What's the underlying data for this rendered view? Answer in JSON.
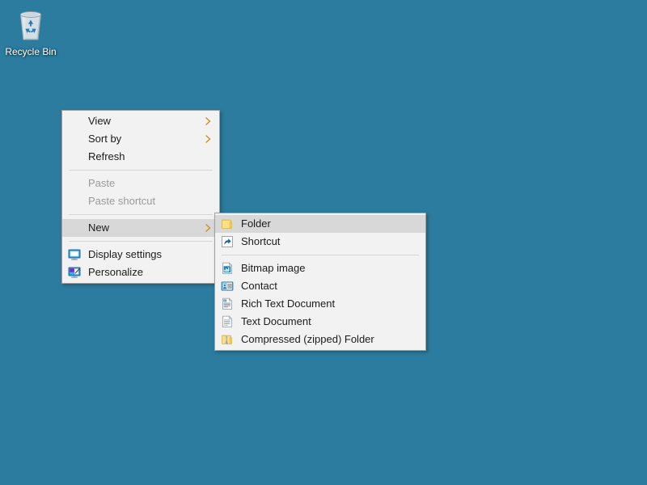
{
  "desktop": {
    "background_color": "#2b7c9e",
    "icons": [
      {
        "name": "recycle-bin",
        "label": "Recycle Bin",
        "icon": "recycle-bin-icon"
      }
    ]
  },
  "context_menu": {
    "items": [
      {
        "label": "View",
        "icon": "none",
        "submenu": true,
        "disabled": false,
        "highlight": false
      },
      {
        "label": "Sort by",
        "icon": "none",
        "submenu": true,
        "disabled": false,
        "highlight": false
      },
      {
        "label": "Refresh",
        "icon": "none",
        "submenu": false,
        "disabled": false,
        "highlight": false
      },
      {
        "separator": true
      },
      {
        "label": "Paste",
        "icon": "none",
        "submenu": false,
        "disabled": true,
        "highlight": false
      },
      {
        "label": "Paste shortcut",
        "icon": "none",
        "submenu": false,
        "disabled": true,
        "highlight": false
      },
      {
        "separator": true
      },
      {
        "label": "New",
        "icon": "none",
        "submenu": true,
        "disabled": false,
        "highlight": true
      },
      {
        "separator": true
      },
      {
        "label": "Display settings",
        "icon": "monitor-icon",
        "submenu": false,
        "disabled": false,
        "highlight": false
      },
      {
        "label": "Personalize",
        "icon": "monitor-brush-icon",
        "submenu": false,
        "disabled": false,
        "highlight": false
      }
    ]
  },
  "submenu": {
    "parent": "New",
    "items": [
      {
        "label": "Folder",
        "icon": "folder-icon",
        "highlight": true
      },
      {
        "label": "Shortcut",
        "icon": "shortcut-icon",
        "highlight": false
      },
      {
        "separator": true
      },
      {
        "label": "Bitmap image",
        "icon": "bitmap-image-icon",
        "highlight": false
      },
      {
        "label": "Contact",
        "icon": "contact-icon",
        "highlight": false
      },
      {
        "label": "Rich Text Document",
        "icon": "rich-text-icon",
        "highlight": false
      },
      {
        "label": "Text Document",
        "icon": "text-document-icon",
        "highlight": false
      },
      {
        "label": "Compressed (zipped) Folder",
        "icon": "zipped-folder-icon",
        "highlight": false
      }
    ]
  },
  "colors": {
    "desktop": "#2b7c9e",
    "menu_background": "#f2f2f2",
    "menu_border": "#a0a0a0",
    "menu_highlight": "#d8d8d8",
    "menu_text": "#1b1b1b",
    "menu_text_disabled": "#9a9a9a",
    "separator": "#d6d6d6",
    "folder_yellow": "#f6d873",
    "shortcut_blue": "#1f5fa8"
  }
}
